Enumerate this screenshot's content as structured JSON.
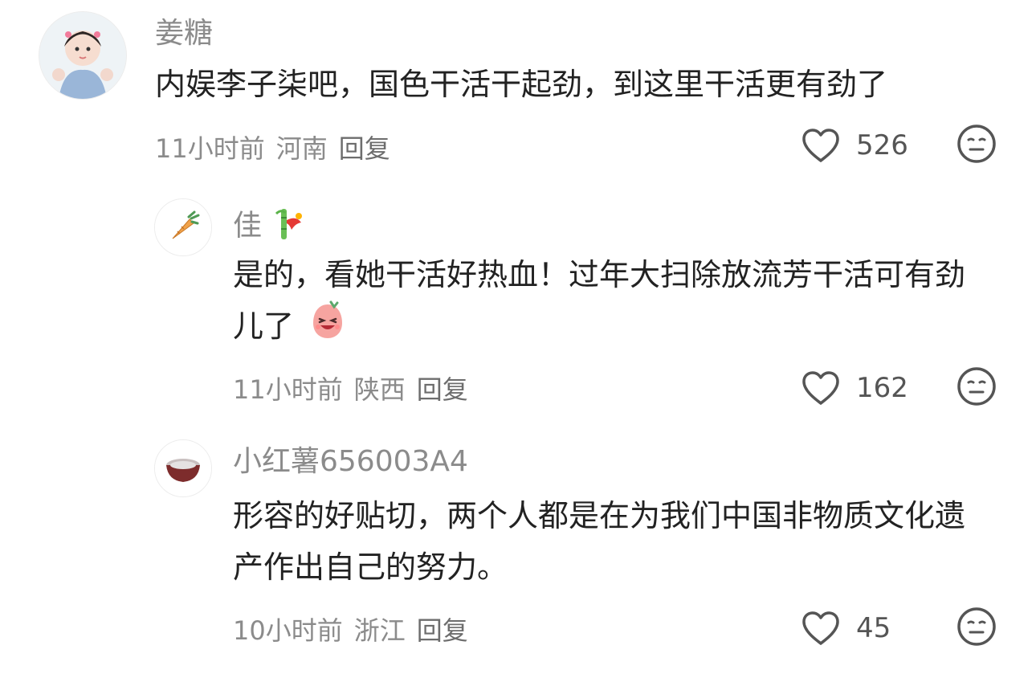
{
  "comments": [
    {
      "username": "姜糖",
      "text": "内娱李子柒吧，国色干活干起劲，到这里干活更有劲了",
      "time": "11小时前",
      "location": "河南",
      "reply_label": "回复",
      "likes": "526",
      "avatar": "toddler-photo"
    },
    {
      "username": "佳",
      "username_badge": "bamboo-flower-emoji",
      "text": "是的，看她干活好热血！过年大扫除放流芳干活可有劲儿了",
      "text_emoji": "laughing-blob-emoji",
      "time": "11小时前",
      "location": "陕西",
      "reply_label": "回复",
      "likes": "162",
      "avatar": "carrot-emoji"
    },
    {
      "username": "小红薯656003A4",
      "text": "形容的好贴切，两个人都是在为我们中国非物质文化遗产作出自己的努力。",
      "time": "10小时前",
      "location": "浙江",
      "reply_label": "回复",
      "likes": "45",
      "avatar": "bowl-icon"
    }
  ],
  "colors": {
    "username": "#8b8b8b",
    "body_text": "#222222",
    "meta_text": "#8b8b8b",
    "icon_stroke": "#555555"
  }
}
